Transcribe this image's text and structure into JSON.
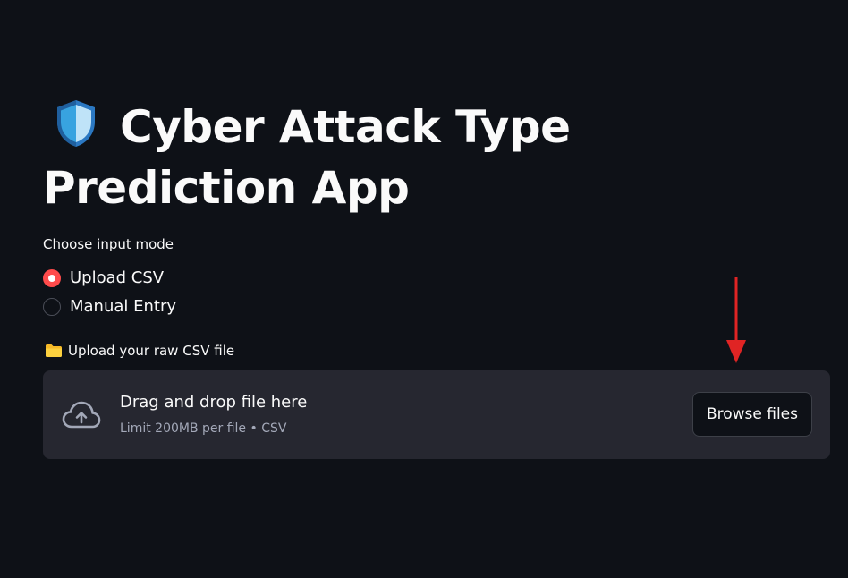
{
  "title": "Cyber Attack Type Prediction App",
  "title_icon": "shield-icon",
  "input_mode": {
    "label": "Choose input mode",
    "options": [
      "Upload CSV",
      "Manual Entry"
    ],
    "selected": "Upload CSV"
  },
  "uploader": {
    "label": "Upload your raw CSV file",
    "label_icon": "folder-icon",
    "dropzone_title": "Drag and drop file here",
    "dropzone_subtitle": "Limit 200MB per file • CSV",
    "upload_icon": "cloud-upload-icon",
    "browse_label": "Browse files"
  },
  "annotation": {
    "icon": "arrow-down-icon",
    "color": "#e02424"
  },
  "colors": {
    "background": "#0e1117",
    "accent": "#ff4b4b",
    "dropzone": "#262730",
    "text": "#fafafa",
    "muted": "#a3a8b8"
  }
}
